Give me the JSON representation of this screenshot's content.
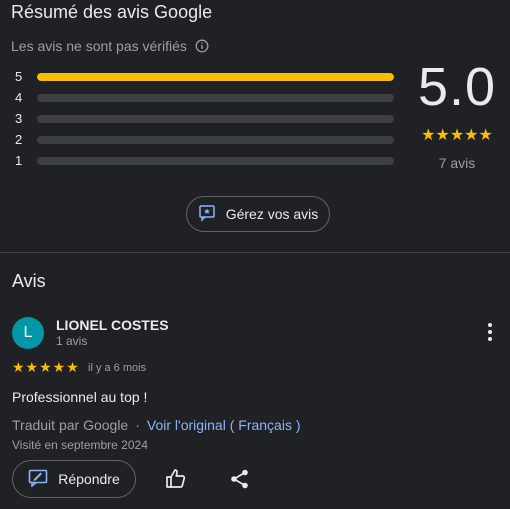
{
  "summary": {
    "title": "Résumé des avis Google",
    "verify_note": "Les avis ne sont pas vérifiés",
    "score": "5.0",
    "stars": "★★★★★",
    "count": "7 avis",
    "bars": [
      {
        "label": "5",
        "fraction": 1.0
      },
      {
        "label": "4",
        "fraction": 0.0
      },
      {
        "label": "3",
        "fraction": 0.0
      },
      {
        "label": "2",
        "fraction": 0.0
      },
      {
        "label": "1",
        "fraction": 0.0
      }
    ],
    "manage_label": "Gérez vos avis"
  },
  "reviews_section": {
    "title": "Avis"
  },
  "review": {
    "avatar_letter": "L",
    "avatar_color": "#0097a7",
    "name": "LIONEL COSTES",
    "meta": "1 avis",
    "stars": "★★★★★",
    "date": "il y a 6 mois",
    "text": "Professionnel au top !",
    "translated_by": "Traduit par Google",
    "separator": "·",
    "original_link": "Voir l'original ( Français )",
    "visited": "Visité en septembre 2024",
    "reply_label": "Répondre"
  },
  "colors": {
    "background": "#202124",
    "star": "#fbbc04",
    "link": "#8ab4f8"
  },
  "icons": {
    "info": "info-icon",
    "manage": "review-edit-icon",
    "more": "more-vert-icon",
    "reply": "reply-icon",
    "like": "thumb-up-icon",
    "share": "share-icon"
  }
}
